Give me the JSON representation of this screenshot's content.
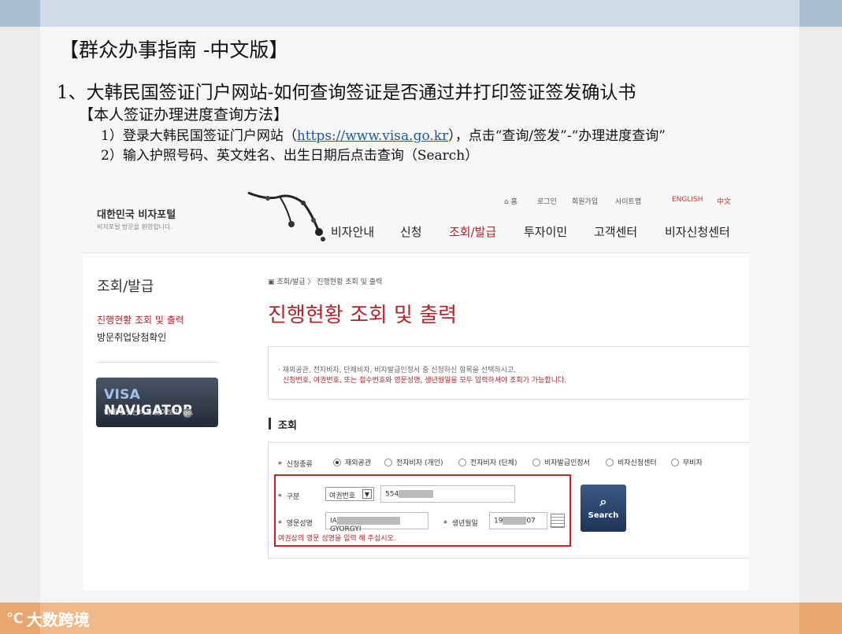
{
  "slide": {
    "title": "【群众办事指南 -中文版】",
    "heading": "1、大韩民国签证门户网站-如何查询签证是否通过并打印签证签发确认书",
    "subheading": "【本人签证办理进度查询方法】",
    "step1_prefix": "1）登录大韩民国签证门户网站（",
    "step1_link": "https://www.visa.go.kr",
    "step1_suffix": "），点击“查询/签发”-“办理进度查询”",
    "step2": "2）输入护照号码、英文姓名、出生日期后点击查询（Search）",
    "footer_logo_mark": "℃",
    "footer_logo_text": "大数跨境"
  },
  "site": {
    "brand": "대한민국 비자포털",
    "brand_sub": "비자포털 방문을 환영합니다.",
    "util": {
      "home": "홈",
      "login": "로그인",
      "join": "회원가입",
      "sitemap": "사이트맵",
      "english": "ENGLISH",
      "chinese": "中文"
    },
    "nav": [
      "비자안내",
      "신청",
      "조회/발급",
      "투자이민",
      "고객센터",
      "비자신청센터"
    ],
    "left": {
      "title": "조회/발급",
      "item1": "진행현황 조회 및 출력",
      "item2": "방문취업당첨확인"
    },
    "visa_nav": {
      "title_a": "VISA",
      "title_b": "NAVIGATOR",
      "sub": "나에게 맞는비자 찾아보기"
    },
    "breadcrumb": "조회/발급 〉 진행현황 조회 및 출력",
    "main_title": "진행현황 조회 및 출력",
    "notice_line1": "· 재외공관, 전자비자, 단체비자, 비자발급인정서 중 신청하신 항목을 선택하시고,",
    "notice_line2": "신청번호, 여권번호, 또는 접수번호와 영문성명, 생년월일을 모두 입력하셔야 조회가 가능합니다.",
    "section": "조회",
    "form": {
      "type_label": "신청종류",
      "types": [
        "재외공관",
        "전자비자 (개인)",
        "전자비자 (단체)",
        "비자발급인정서",
        "비자신청센터",
        "무비자"
      ],
      "div_label": "구분",
      "div_select": "여권번호",
      "passport_prefix": "554",
      "name_label": "영문성명",
      "name_prefix": "IA",
      "name_suffix": "GYORGYI",
      "birth_label": "생년월일",
      "birth_prefix": "19",
      "birth_suffix": "07",
      "hint": "여권상의 영문 성명을 입력 해 주십시오.",
      "search": "Search"
    }
  }
}
